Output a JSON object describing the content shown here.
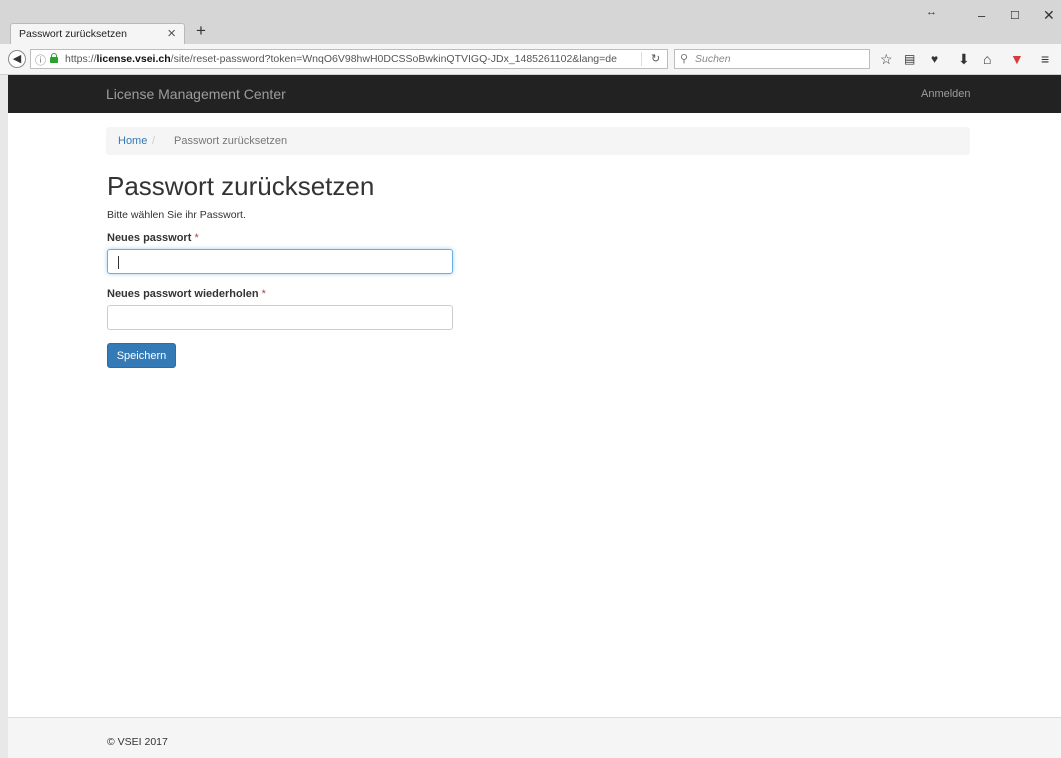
{
  "browser": {
    "tab_title": "Passwort zurücksetzen",
    "tab_close": "×",
    "new_tab": "+",
    "url_host": "license.vsei.ch",
    "url_prefix": "https://",
    "url_path": "/site/reset-password?token=WnqO6V98hwH0DCSSoBwkinQTVIGQ-JDx_1485261102&lang=de",
    "search_placeholder": "Suchen"
  },
  "site": {
    "brand": "License Management Center",
    "login_link": "Anmelden"
  },
  "breadcrumb": {
    "home": "Home",
    "separator": "/",
    "current": "Passwort zurücksetzen"
  },
  "form": {
    "title": "Passwort zurücksetzen",
    "intro": "Bitte wählen Sie ihr Passwort.",
    "new_password_label": "Neues passwort",
    "repeat_password_label": "Neues passwort wiederholen",
    "required_marker": "*",
    "new_password_value": "",
    "repeat_password_value": "",
    "save_button": "Speichern"
  },
  "footer": {
    "copyright": "© VSEI 2017"
  },
  "icons": {
    "back": "back-arrow-icon",
    "info": "info-icon",
    "lock": "lock-icon",
    "reload": "reload-icon",
    "search": "search-icon",
    "bookmark": "bookmark-star-icon",
    "reading_list": "reading-list-icon",
    "pocket": "pocket-icon",
    "download": "download-icon",
    "home": "home-icon",
    "shield": "shield-icon",
    "menu": "menu-icon"
  },
  "colors": {
    "navbar_bg": "#222222",
    "link": "#337ab7",
    "primary_button": "#337ab7",
    "required": "#a94442",
    "focus_border": "#66afe9"
  }
}
